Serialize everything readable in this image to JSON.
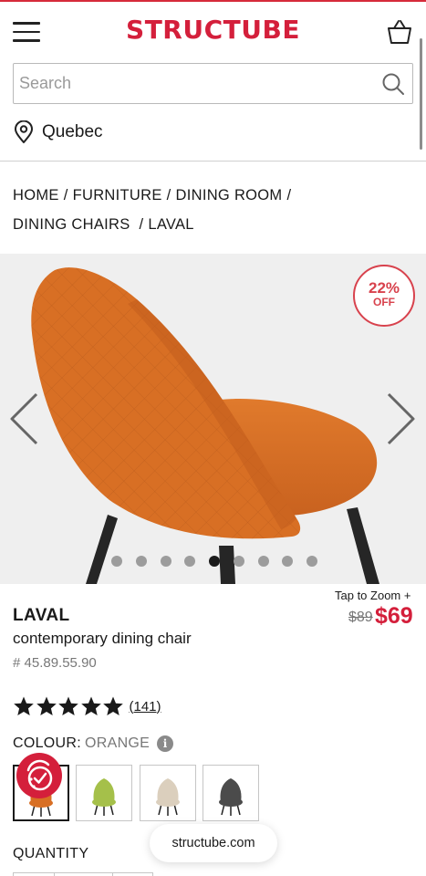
{
  "colors": {
    "brand": "#d41f3b",
    "badge": "#d8424d",
    "chair": "#d86f24",
    "lime": "#a5c04a",
    "beige": "#dbcfbd",
    "grey": "#4b4b4b"
  },
  "icons": {
    "menu": "hamburger-icon",
    "cart": "basket-icon",
    "search": "search-icon",
    "location": "location-pin-icon",
    "prev": "chevron-left-icon",
    "next": "chevron-right-icon",
    "star": "star-icon",
    "info": "info-icon",
    "promo": "promo-badge-icon"
  },
  "header": {
    "logo": "STRUCTUBE"
  },
  "search": {
    "placeholder": "Search",
    "value": ""
  },
  "location": {
    "label": "Quebec"
  },
  "breadcrumb": {
    "items": [
      "HOME",
      "FURNITURE",
      "DINING ROOM",
      "DINING CHAIRS",
      "LAVAL"
    ],
    "separator": "/"
  },
  "gallery": {
    "badge_pct": "22%",
    "badge_off": "OFF",
    "dots_total": 9,
    "active_dot": 5
  },
  "product": {
    "tap_to_zoom": "Tap to Zoom +",
    "name": "LAVAL",
    "description": "contemporary dining chair",
    "sku": "# 45.89.55.90",
    "price_old": "$89",
    "price_new": "$69",
    "rating": 5,
    "reviews": "(141)"
  },
  "colour": {
    "label": "COLOUR:",
    "value": "ORANGE",
    "info": "i",
    "swatches": [
      "orange",
      "lime",
      "beige",
      "grey"
    ],
    "selected": "orange"
  },
  "quantity": {
    "label": "QUANTITY"
  },
  "browser": {
    "url": "structube.com"
  }
}
